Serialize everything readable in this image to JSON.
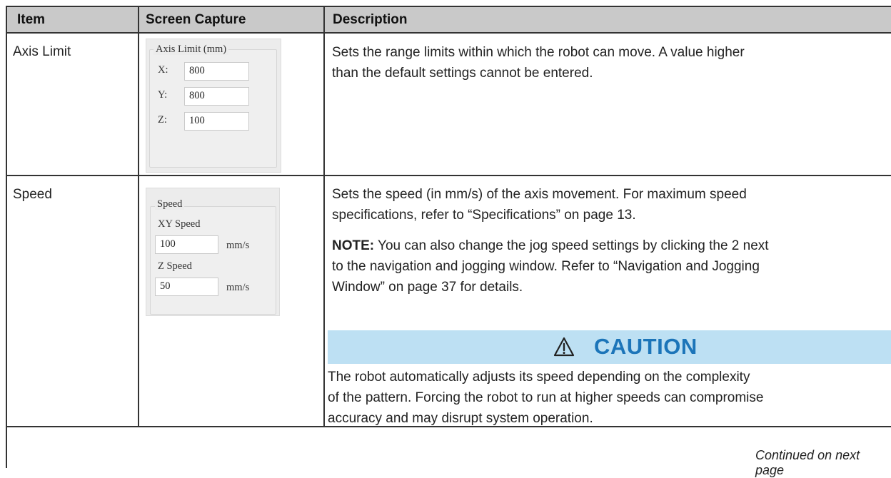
{
  "header": {
    "item": "Item",
    "screen_capture": "Screen Capture",
    "description": "Description"
  },
  "rows": [
    {
      "item": "Axis Limit",
      "capture": {
        "group_title": "Axis Limit (mm)",
        "x_label": "X:",
        "x_value": "800",
        "y_label": "Y:",
        "y_value": "800",
        "z_label": "Z:",
        "z_value": "100"
      },
      "description_lines": [
        "Sets the range limits within which the robot can move. A value higher",
        "than the default settings cannot be entered."
      ]
    },
    {
      "item": "Speed",
      "capture": {
        "group_title": "Speed",
        "xy_label": "XY Speed",
        "xy_value": "100",
        "xy_unit": "mm/s",
        "z_label": "Z Speed",
        "z_value": "50",
        "z_unit": "mm/s"
      },
      "description_lines": [
        "Sets the speed (in mm/s) of the axis movement. For maximum speed",
        "specifications, refer to “Specifications” on page 13."
      ],
      "note_label": "NOTE:",
      "note_first_line": " You can also change the jog speed settings by clicking the 2 next",
      "note_lines": [
        "to the navigation and jogging window. Refer to “Navigation and Jogging",
        "Window” on page 37 for details."
      ],
      "caution": {
        "title": "CAUTION",
        "icon": "warning-triangle-icon",
        "bar_color": "#bde0f3",
        "title_color": "#1c75b9",
        "lines": [
          "The robot automatically adjusts its speed depending on the complexity",
          "of the pattern. Forcing the robot to run at higher speeds can compromise",
          "accuracy and may disrupt system operation."
        ]
      }
    }
  ],
  "footer": {
    "continued": "Continued on next page"
  }
}
